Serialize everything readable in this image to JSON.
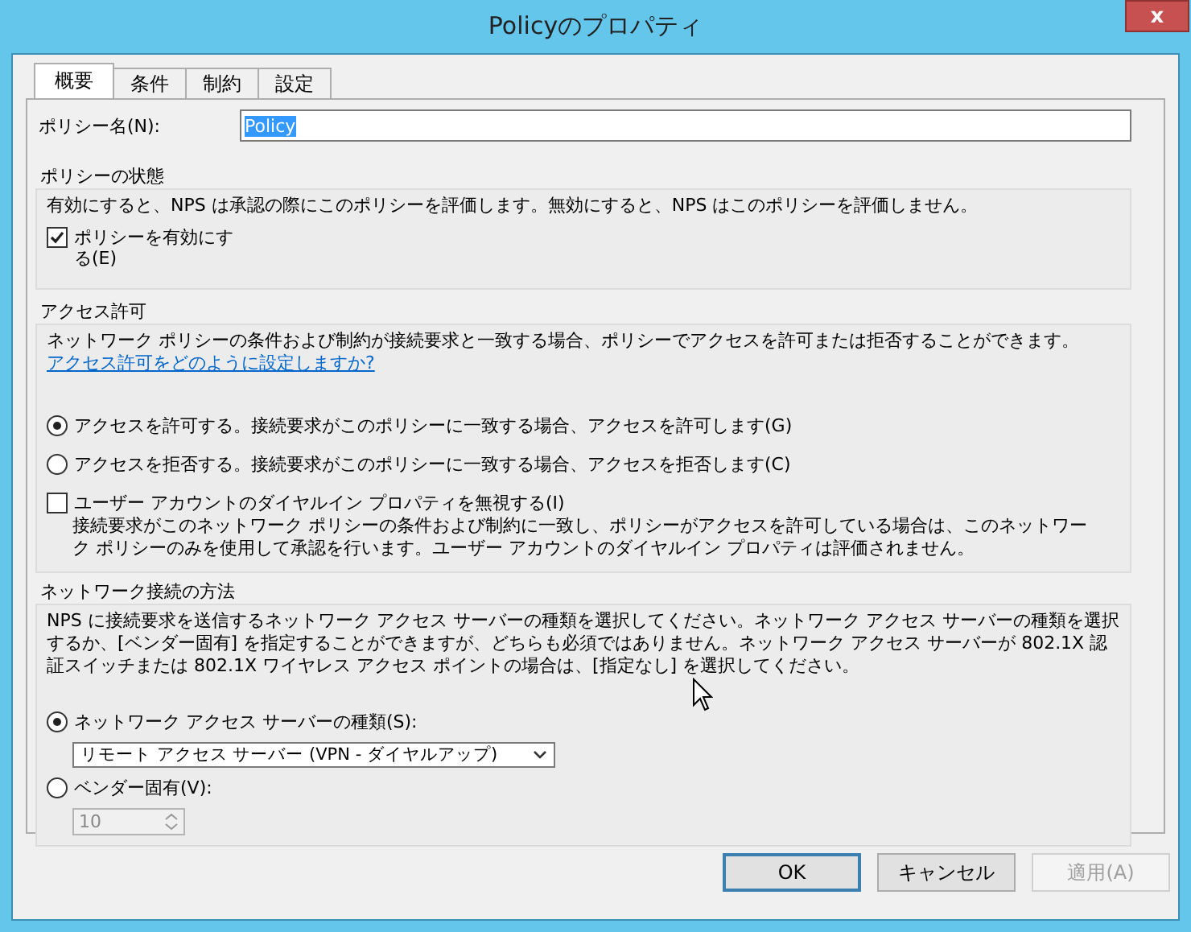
{
  "window": {
    "title": "Policyのプロパティ",
    "close": "x"
  },
  "tabs": [
    {
      "label": "概要",
      "selected": true
    },
    {
      "label": "条件",
      "selected": false
    },
    {
      "label": "制約",
      "selected": false
    },
    {
      "label": "設定",
      "selected": false
    }
  ],
  "policy_name": {
    "label": "ポリシー名(N):",
    "value": "Policy"
  },
  "policy_state": {
    "legend": "ポリシーの状態",
    "description": "有効にすると、NPS は承認の際にこのポリシーを評価します。無効にすると、NPS はこのポリシーを評価しません。",
    "checkbox": {
      "label": "ポリシーを有効にする(E)",
      "checked": true
    }
  },
  "access_permission": {
    "legend": "アクセス許可",
    "description": "ネットワーク ポリシーの条件および制約が接続要求と一致する場合、ポリシーでアクセスを許可または拒否することができます。",
    "link": "アクセス許可をどのように設定しますか?",
    "radios": [
      {
        "label": "アクセスを許可する。接続要求がこのポリシーに一致する場合、アクセスを許可します(G)",
        "selected": true
      },
      {
        "label": "アクセスを拒否する。接続要求がこのポリシーに一致する場合、アクセスを拒否します(C)",
        "selected": false
      }
    ],
    "checkbox": {
      "label": "ユーザー アカウントのダイヤルイン プロパティを無視する(I)",
      "checked": false
    },
    "checkbox_description": "接続要求がこのネットワーク ポリシーの条件および制約に一致し、ポリシーがアクセスを許可している場合は、このネットワーク ポリシーのみを使用して承認を行います。ユーザー アカウントのダイヤルイン プロパティは評価されません。"
  },
  "network_connection": {
    "legend": "ネットワーク接続の方法",
    "description": "NPS に接続要求を送信するネットワーク アクセス サーバーの種類を選択してください。ネットワーク アクセス サーバーの種類を選択するか、[ベンダー固有] を指定することができますが、どちらも必須ではありません。ネットワーク アクセス サーバーが 802.1X 認証スイッチまたは 802.1X ワイヤレス アクセス ポイントの場合は、[指定なし] を選択してください。",
    "radios": [
      {
        "label": "ネットワーク アクセス サーバーの種類(S):",
        "selected": true
      },
      {
        "label": "ベンダー固有(V):",
        "selected": false
      }
    ],
    "dropdown": {
      "value": "リモート アクセス サーバー (VPN - ダイヤルアップ)"
    },
    "spinner": {
      "value": "10",
      "disabled": true
    }
  },
  "buttons": [
    {
      "label": "OK",
      "disabled": false,
      "default": true
    },
    {
      "label": "キャンセル",
      "disabled": false,
      "default": false
    },
    {
      "label": "適用(A)",
      "disabled": true,
      "default": false
    }
  ]
}
